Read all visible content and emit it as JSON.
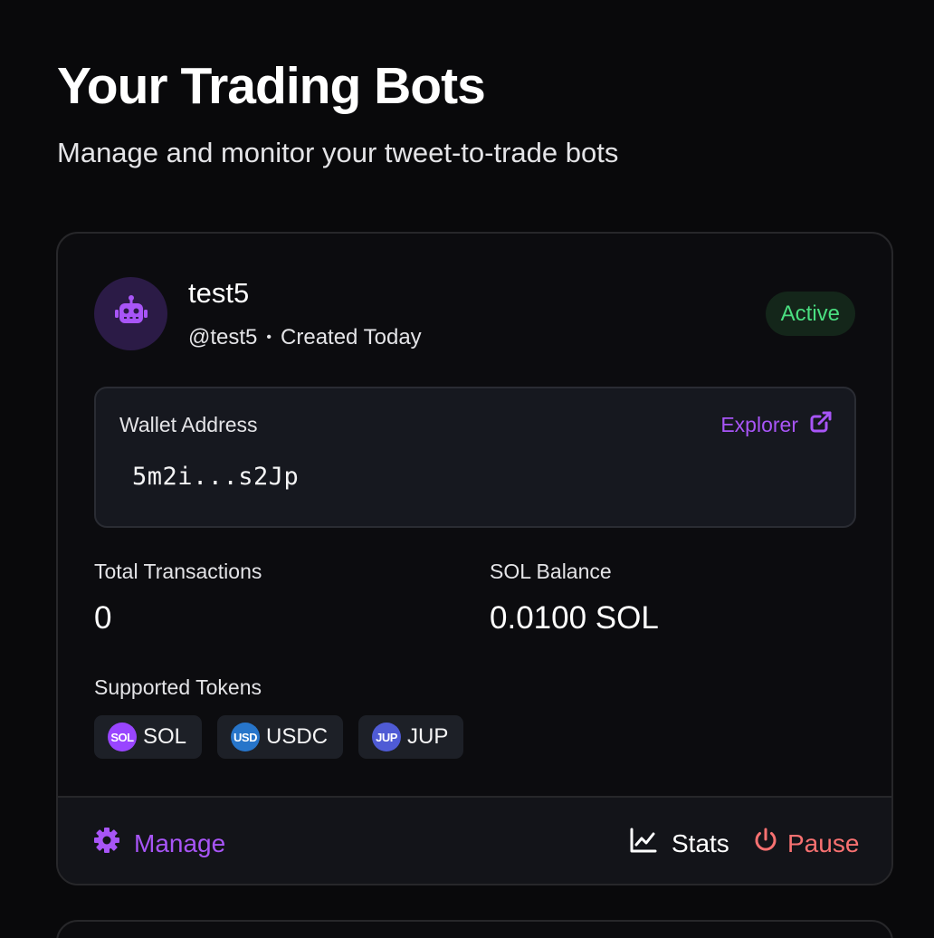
{
  "header": {
    "title": "Your Trading Bots",
    "subtitle": "Manage and monitor your tweet-to-trade bots"
  },
  "bot": {
    "avatar_icon": "robot-icon",
    "name": "test5",
    "handle": "@test5",
    "separator": "•",
    "created": "Created Today",
    "status": "Active",
    "wallet": {
      "label": "Wallet Address",
      "explorer_label": "Explorer",
      "explorer_icon": "external-link-icon",
      "address": "5m2i...s2Jp"
    },
    "stats": {
      "transactions_label": "Total Transactions",
      "transactions_value": "0",
      "balance_label": "SOL Balance",
      "balance_value": "0.0100 SOL"
    },
    "tokens_label": "Supported Tokens",
    "tokens": [
      {
        "icon_text": "SOL",
        "label": "SOL",
        "color": "#9945ff"
      },
      {
        "icon_text": "USD",
        "label": "USDC",
        "color": "#2775ca"
      },
      {
        "icon_text": "JUP",
        "label": "JUP",
        "color": "#4f5bd5"
      }
    ],
    "footer": {
      "manage_label": "Manage",
      "manage_icon": "gear-icon",
      "stats_label": "Stats",
      "stats_icon": "chart-line-icon",
      "pause_label": "Pause",
      "pause_icon": "power-icon"
    }
  },
  "colors": {
    "accent": "#a855f7",
    "active": "#4ade80",
    "danger": "#f87171",
    "background": "#09090b"
  }
}
